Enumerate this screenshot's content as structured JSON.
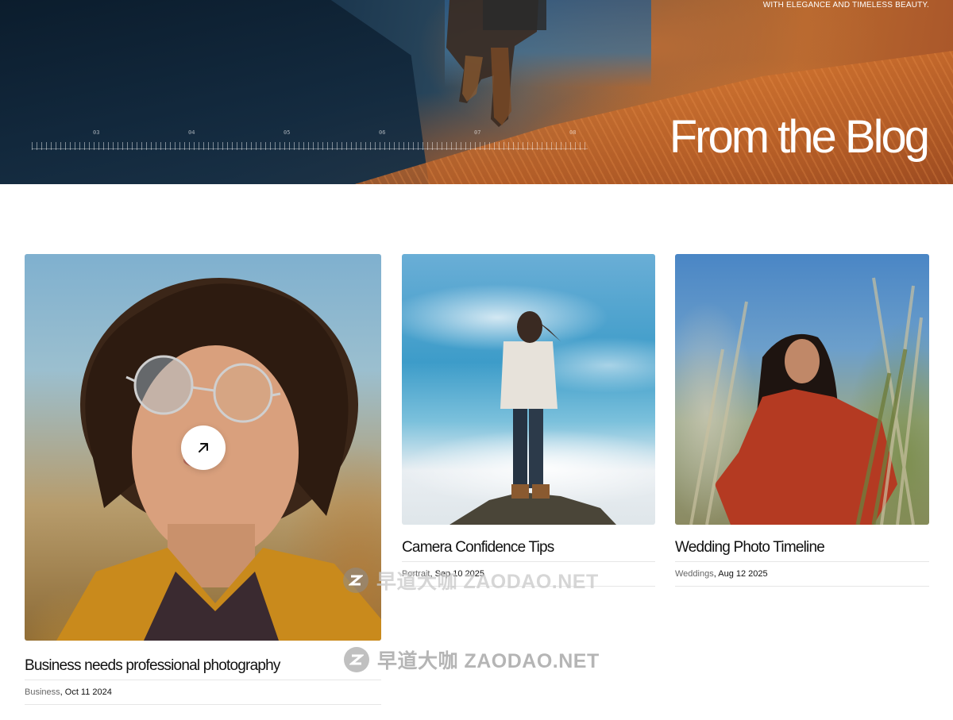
{
  "hero": {
    "tagline": "WITH ELEGANCE AND TIMELESS BEAUTY.",
    "title": "From the Blog",
    "ruler_labels": [
      "03",
      "04",
      "05",
      "06",
      "07",
      "08"
    ]
  },
  "posts": [
    {
      "title": "Business needs professional photography",
      "category": "Business",
      "separator": ", ",
      "date": "Oct 11 2024",
      "has_arrow_button": true
    },
    {
      "title": "Camera Confidence Tips",
      "category": "Portrait",
      "separator": ", ",
      "date": "Sep 10 2025"
    },
    {
      "title": "Wedding Photo Timeline",
      "category": "Weddings",
      "separator": ", ",
      "date": "Aug 12 2025"
    }
  ],
  "icons": {
    "arrow_button": "arrow-up-right-icon"
  },
  "watermark": {
    "text": "早道大咖  ZAODAO.NET"
  },
  "colors": {
    "background": "#ffffff",
    "title_text": "#111111",
    "meta_category": "#666666",
    "divider": "#e6e6e6"
  }
}
